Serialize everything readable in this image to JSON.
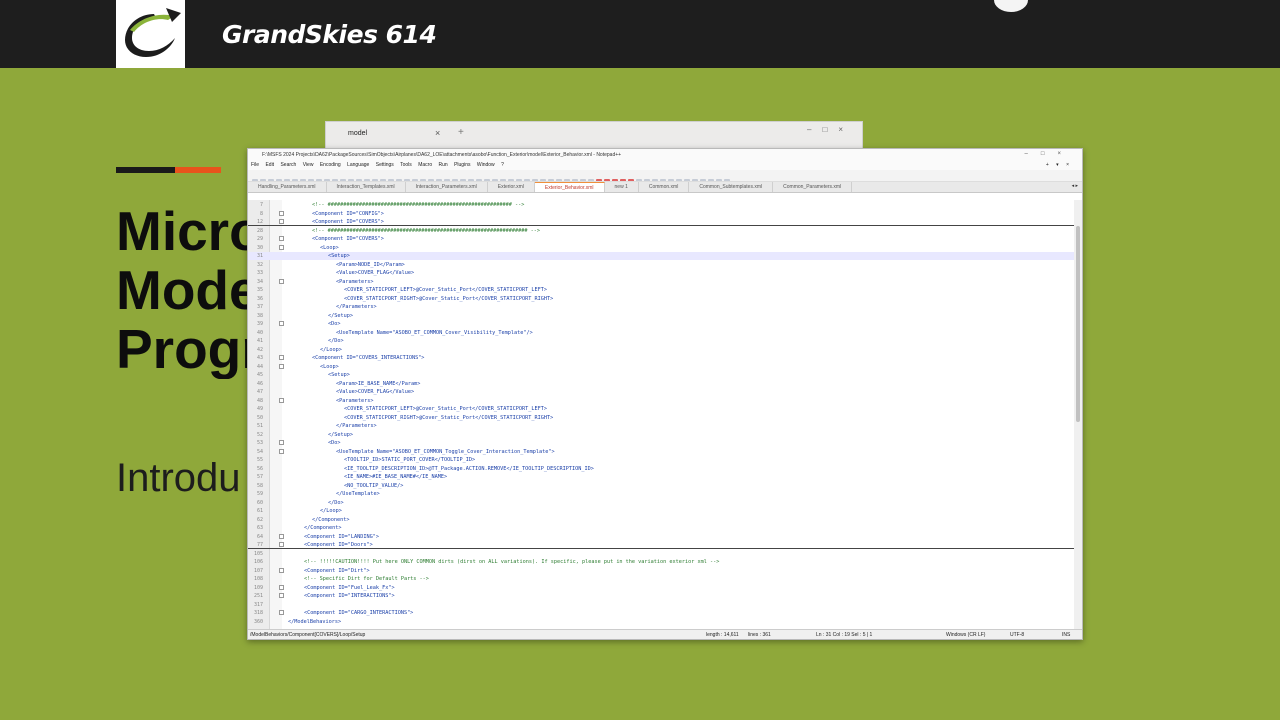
{
  "header": {
    "brand": "GrandSkies 614"
  },
  "slide": {
    "headline_lines": [
      "Micro",
      "Mode",
      "Progr"
    ],
    "subtitle": "Introdu"
  },
  "explorer": {
    "title": "model"
  },
  "editor": {
    "title_path": "F:\\MSFS 2024 Projects\\DA62\\PackageSources\\SimObjects\\Airplanes\\DA62_LOE\\attachments\\asobo\\Function_Exterior\\model\\Exterior_Behavior.xml - Notepad++",
    "menu": [
      "File",
      "Edit",
      "Search",
      "View",
      "Encoding",
      "Language",
      "Settings",
      "Tools",
      "Macro",
      "Run",
      "Plugins",
      "Window",
      "?"
    ],
    "menu_right": "+ ▾ ×",
    "tabs": [
      {
        "label": "Handling_Parameters.xml",
        "active": false
      },
      {
        "label": "Interaction_Templates.xml",
        "active": false
      },
      {
        "label": "Interaction_Parameters.xml",
        "active": false
      },
      {
        "label": "Exterior.xml",
        "active": false
      },
      {
        "label": "Exterior_Behavior.xml",
        "active": true
      },
      {
        "label": "new 1",
        "active": false
      },
      {
        "label": "Common.xml",
        "active": false
      },
      {
        "label": "Common_Subtemplates.xml",
        "active": false
      },
      {
        "label": "Common_Parameters.xml",
        "active": false
      }
    ],
    "lines": [
      {
        "n": "7",
        "indent": 3,
        "text": "<!-- ########################################################### -->",
        "k": "cm"
      },
      {
        "n": "8",
        "indent": 3,
        "text": "<Component ID=\"CONFIG\">",
        "k": "tg",
        "fold": true
      },
      {
        "n": "12",
        "indent": 3,
        "text": "<Component ID=\"COVERS\">",
        "k": "tg",
        "fold": true,
        "sep": true
      },
      {
        "n": "28",
        "indent": 3,
        "text": "<!-- ################################################################ -->",
        "k": "cm"
      },
      {
        "n": "29",
        "indent": 3,
        "text": "<Component ID=\"COVERS\">",
        "k": "tg",
        "fold": true
      },
      {
        "n": "30",
        "indent": 4,
        "text": "<Loop>",
        "k": "tg",
        "fold": true
      },
      {
        "n": "31",
        "indent": 5,
        "text": "<Setup>",
        "k": "tg",
        "cur": true
      },
      {
        "n": "32",
        "indent": 6,
        "text": "<Param>NODE_ID</Param>",
        "k": "tg"
      },
      {
        "n": "33",
        "indent": 6,
        "text": "<Value>COVER_FLAG</Value>",
        "k": "tg"
      },
      {
        "n": "34",
        "indent": 6,
        "text": "<Parameters>",
        "k": "tg",
        "fold": true
      },
      {
        "n": "35",
        "indent": 7,
        "text": "<COVER_STATICPORT_LEFT>@Cover_Static_Port</COVER_STATICPORT_LEFT>",
        "k": "tg"
      },
      {
        "n": "36",
        "indent": 7,
        "text": "<COVER_STATICPORT_RIGHT>@Cover_Static_Port</COVER_STATICPORT_RIGHT>",
        "k": "tg"
      },
      {
        "n": "37",
        "indent": 6,
        "text": "</Parameters>",
        "k": "tg"
      },
      {
        "n": "38",
        "indent": 5,
        "text": "</Setup>",
        "k": "tg"
      },
      {
        "n": "39",
        "indent": 5,
        "text": "<Do>",
        "k": "tg",
        "fold": true
      },
      {
        "n": "40",
        "indent": 6,
        "text": "<UseTemplate Name=\"ASOBO_ET_COMMON_Cover_Visibility_Template\"/>",
        "k": "tg"
      },
      {
        "n": "41",
        "indent": 5,
        "text": "</Do>",
        "k": "tg"
      },
      {
        "n": "42",
        "indent": 4,
        "text": "</Loop>",
        "k": "tg"
      },
      {
        "n": "43",
        "indent": 3,
        "text": "<Component ID=\"COVERS_INTERACTIONS\">",
        "k": "tg",
        "fold": true
      },
      {
        "n": "44",
        "indent": 4,
        "text": "<Loop>",
        "k": "tg",
        "fold": true
      },
      {
        "n": "45",
        "indent": 5,
        "text": "<Setup>",
        "k": "tg"
      },
      {
        "n": "46",
        "indent": 6,
        "text": "<Param>IE_BASE_NAME</Param>",
        "k": "tg"
      },
      {
        "n": "47",
        "indent": 6,
        "text": "<Value>COVER_FLAG</Value>",
        "k": "tg"
      },
      {
        "n": "48",
        "indent": 6,
        "text": "<Parameters>",
        "k": "tg",
        "fold": true
      },
      {
        "n": "49",
        "indent": 7,
        "text": "<COVER_STATICPORT_LEFT>@Cover_Static_Port</COVER_STATICPORT_LEFT>",
        "k": "tg"
      },
      {
        "n": "50",
        "indent": 7,
        "text": "<COVER_STATICPORT_RIGHT>@Cover_Static_Port</COVER_STATICPORT_RIGHT>",
        "k": "tg"
      },
      {
        "n": "51",
        "indent": 6,
        "text": "</Parameters>",
        "k": "tg"
      },
      {
        "n": "52",
        "indent": 5,
        "text": "</Setup>",
        "k": "tg"
      },
      {
        "n": "53",
        "indent": 5,
        "text": "<Do>",
        "k": "tg",
        "fold": true
      },
      {
        "n": "54",
        "indent": 6,
        "text": "<UseTemplate Name=\"ASOBO_ET_COMMON_Toggle_Cover_Interaction_Template\">",
        "k": "tg",
        "fold": true
      },
      {
        "n": "55",
        "indent": 7,
        "text": "<TOOLTIP_ID>STATIC_PORT_COVER</TOOLTIP_ID>",
        "k": "tg"
      },
      {
        "n": "56",
        "indent": 7,
        "text": "<IE_TOOLTIP_DESCRIPTION_ID>@TT_Package.ACTION.REMOVE</IE_TOOLTIP_DESCRIPTION_ID>",
        "k": "tg"
      },
      {
        "n": "57",
        "indent": 7,
        "text": "<IE_NAME>#IE_BASE_NAME#</IE_NAME>",
        "k": "tg"
      },
      {
        "n": "58",
        "indent": 7,
        "text": "<NO_TOOLTIP_VALUE/>",
        "k": "tg"
      },
      {
        "n": "59",
        "indent": 6,
        "text": "</UseTemplate>",
        "k": "tg"
      },
      {
        "n": "60",
        "indent": 5,
        "text": "</Do>",
        "k": "tg"
      },
      {
        "n": "61",
        "indent": 4,
        "text": "</Loop>",
        "k": "tg"
      },
      {
        "n": "62",
        "indent": 3,
        "text": "</Component>",
        "k": "tg"
      },
      {
        "n": "63",
        "indent": 2,
        "text": "</Component>",
        "k": "tg"
      },
      {
        "n": "64",
        "indent": 2,
        "text": "<Component ID=\"LANDING\">",
        "k": "tg",
        "fold": true
      },
      {
        "n": "77",
        "indent": 2,
        "text": "<Component ID=\"Doors\">",
        "k": "tg",
        "fold": true,
        "sep": true
      },
      {
        "n": "105",
        "indent": 0,
        "text": "",
        "k": "tg"
      },
      {
        "n": "106",
        "indent": 2,
        "text": "<!-- !!!!!CAUTION!!!! Put here ONLY COMMON dirts (dirst on ALL variations). If specific, please put in the variation exterior xml -->",
        "k": "cm"
      },
      {
        "n": "107",
        "indent": 2,
        "text": "<Component ID=\"Dirt\">",
        "k": "tg",
        "fold": true
      },
      {
        "n": "108",
        "indent": 2,
        "text": "<!-- Specific Dirt for Default Parts -->",
        "k": "cm"
      },
      {
        "n": "109",
        "indent": 2,
        "text": "<Component ID=\"Fuel_Leak_Fx\">",
        "k": "tg",
        "fold": true
      },
      {
        "n": "251",
        "indent": 2,
        "text": "<Component ID=\"INTERACTIONS\">",
        "k": "tg",
        "fold": true
      },
      {
        "n": "317",
        "indent": 0,
        "text": "",
        "k": "tg"
      },
      {
        "n": "318",
        "indent": 2,
        "text": "<Component ID=\"CARGO_INTERACTIONS\">",
        "k": "tg",
        "fold": true
      },
      {
        "n": "360",
        "indent": 0,
        "text": "</ModelBehaviors>",
        "k": "tg"
      }
    ],
    "status": {
      "path": "/ModelBehaviors/Component[COVERS]/Loop/Setup",
      "length": "length : 14,611",
      "lines": "lines : 361",
      "pos": "Ln : 31    Col : 19    Sel : 5 | 1",
      "eol": "Windows (CR LF)",
      "enc": "UTF-8",
      "ins": "INS"
    }
  }
}
